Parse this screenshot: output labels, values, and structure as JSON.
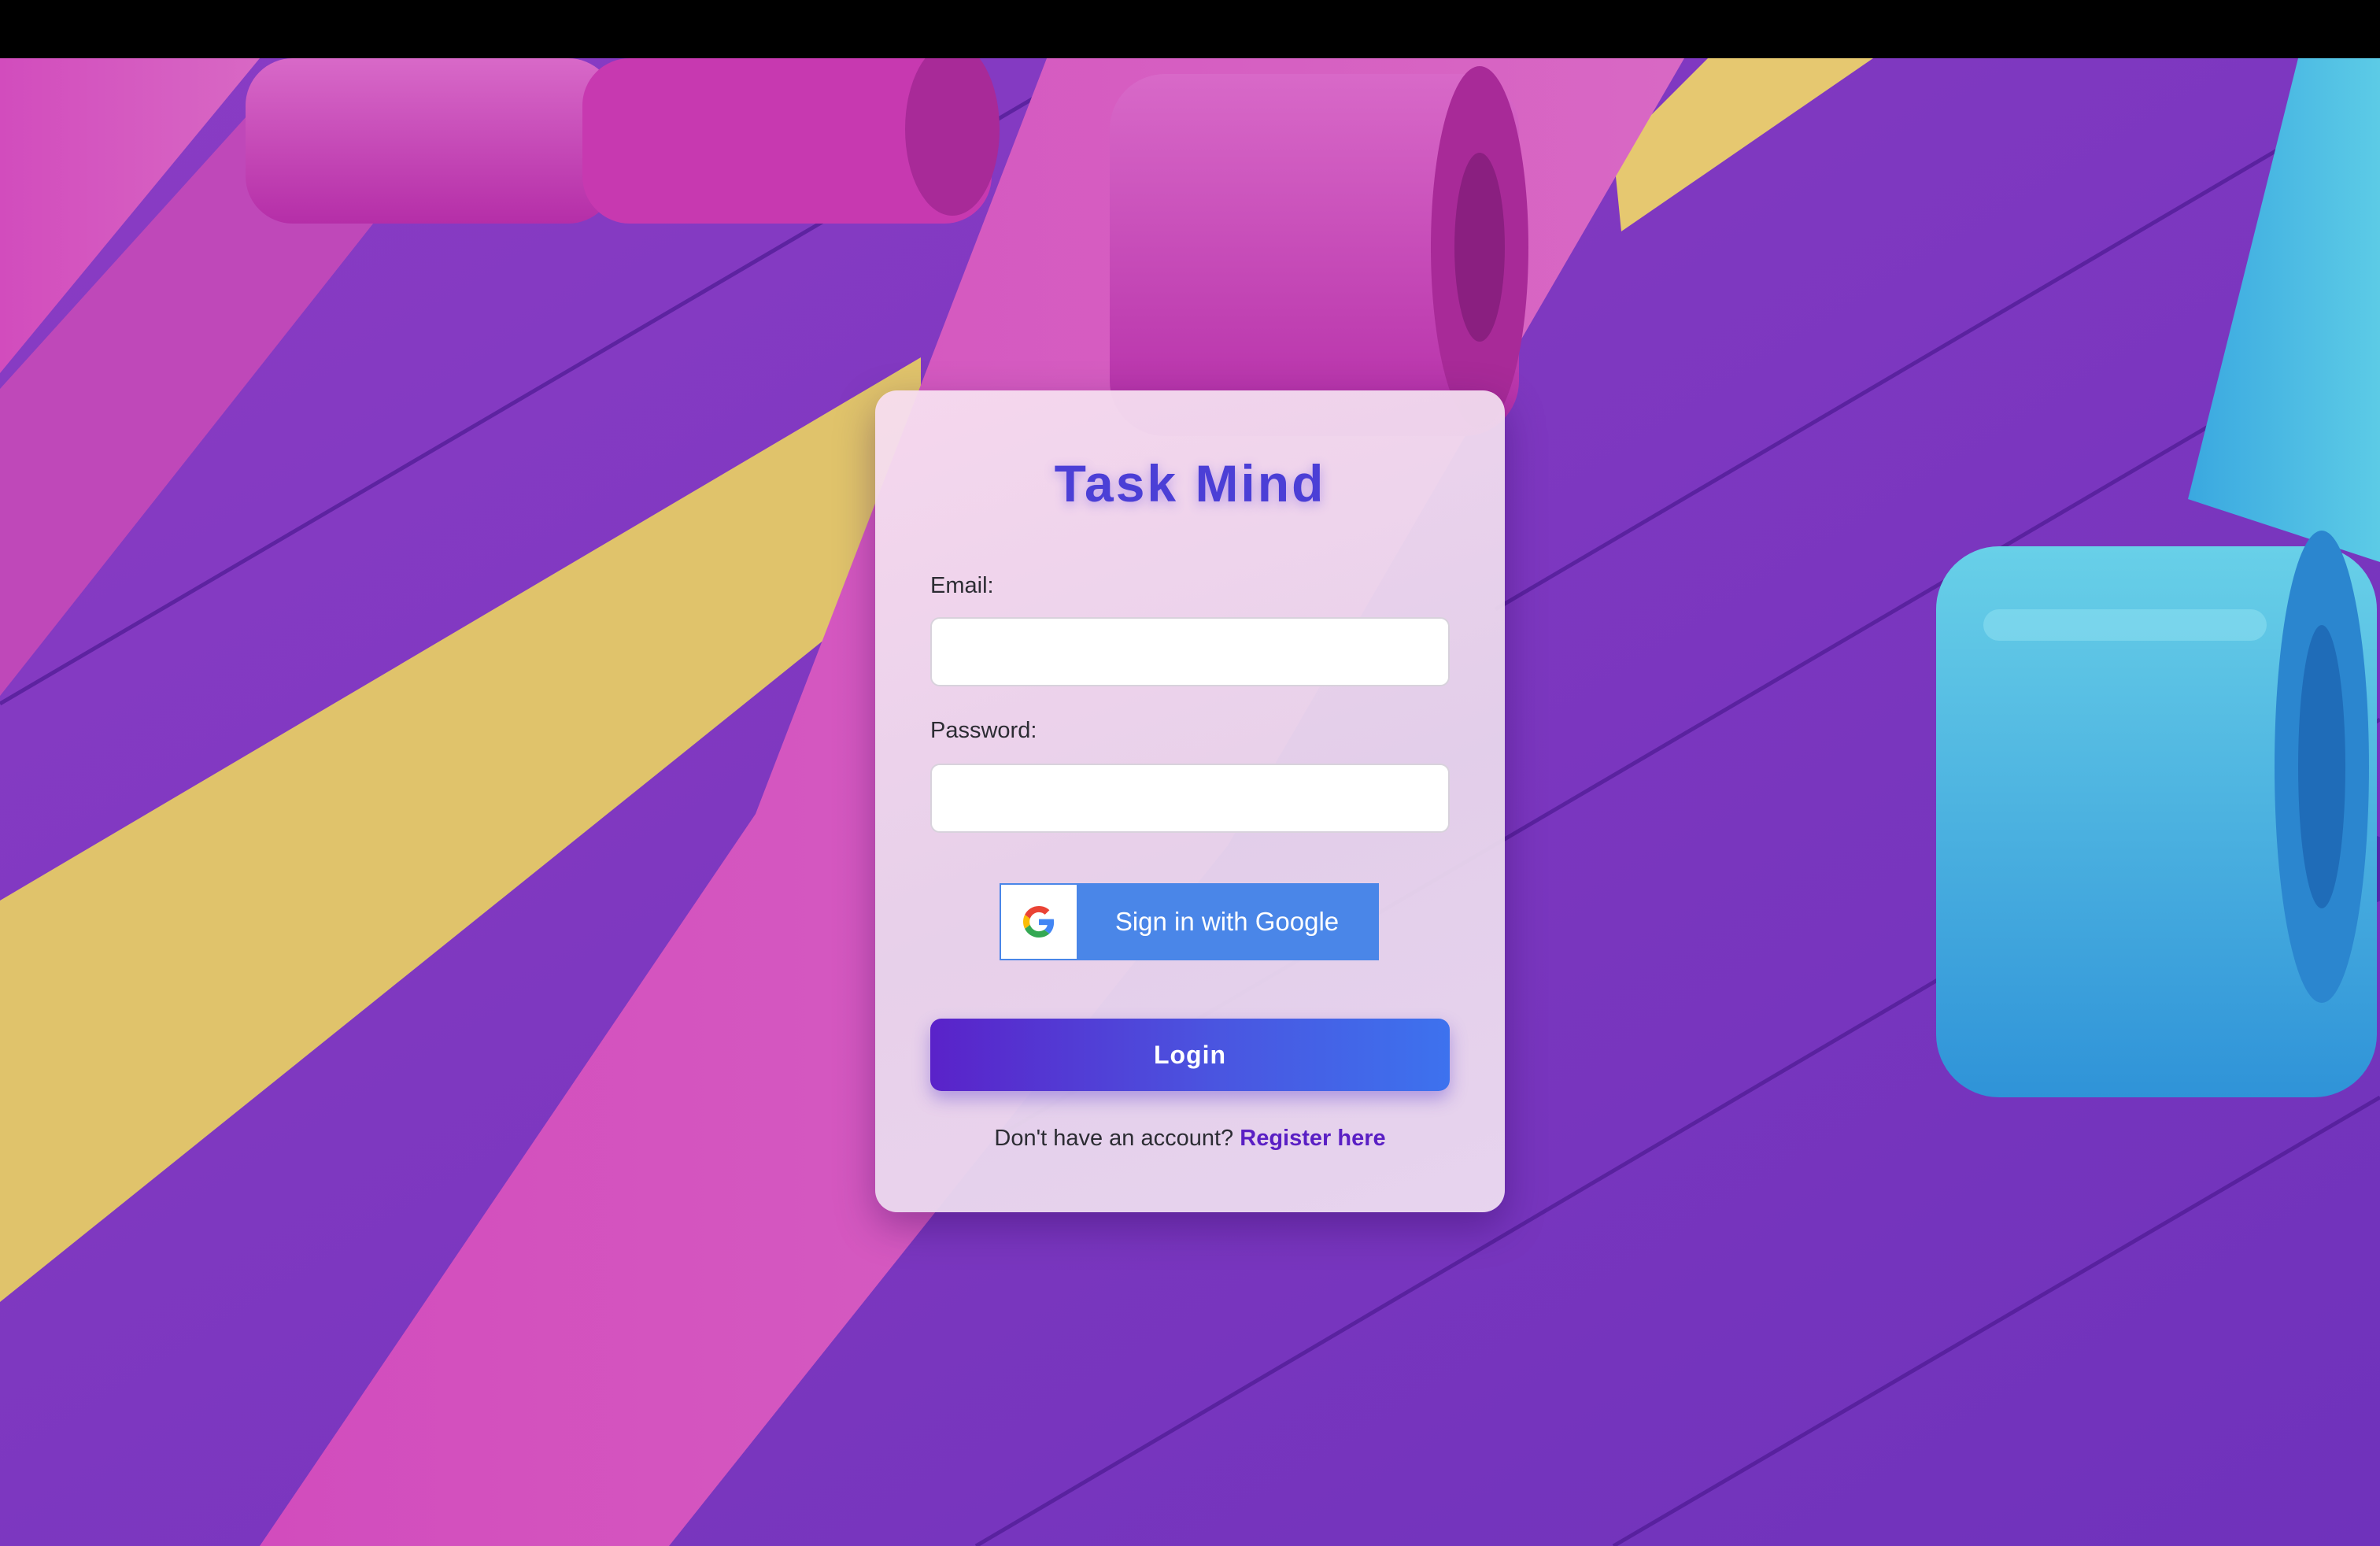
{
  "app": {
    "title": "Task Mind"
  },
  "form": {
    "email_label": "Email:",
    "email_value": "",
    "password_label": "Password:",
    "password_value": "",
    "google_button_label": "Sign in with Google",
    "login_button_label": "Login",
    "register_prompt": "Don't have an account?",
    "register_link_label": "Register here"
  },
  "colors": {
    "title": "#4b3fd6",
    "google_blue": "#4a86e8",
    "login_gradient_start": "#5a22c9",
    "login_gradient_end": "#3d72ee",
    "register_link": "#5a1fc4",
    "background_purple": "#7c3cc0",
    "ribbon_pink": "#d35fc2",
    "ribbon_yellow": "#e0c36b",
    "ribbon_cyan": "#3fb3e0"
  },
  "icons": {
    "google": "google-g-icon"
  }
}
